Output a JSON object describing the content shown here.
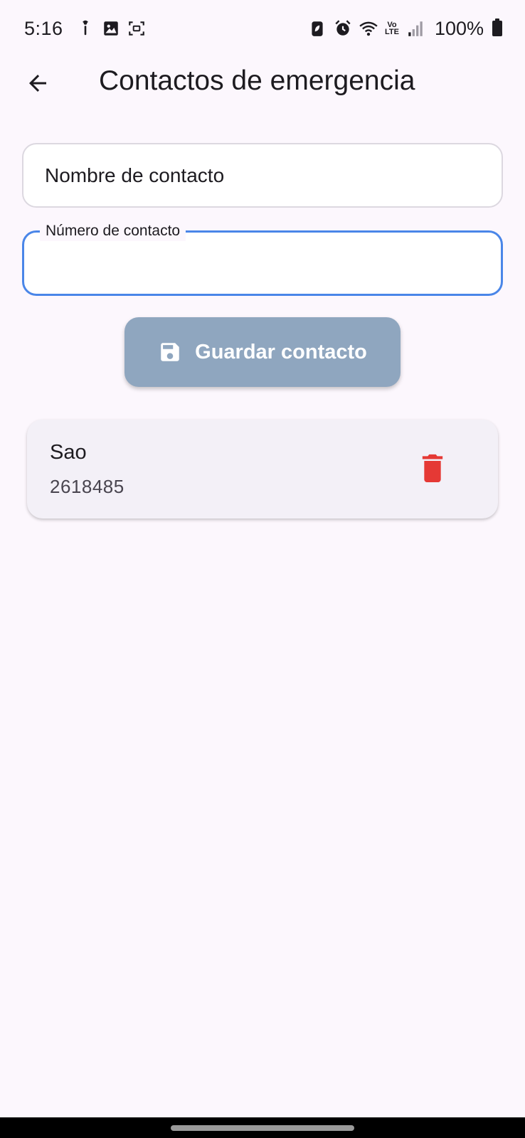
{
  "status_bar": {
    "time": "5:16",
    "battery": "100%",
    "network": [
      "Vo",
      "LTE"
    ],
    "left_icons": [
      "hotspot-icon",
      "image-icon",
      "screenshot-icon"
    ],
    "right_icons": [
      "battery-saver-icon",
      "alarm-icon",
      "wifi-icon",
      "volte-icon",
      "signal-icon",
      "battery-icon"
    ]
  },
  "app_bar": {
    "title": "Contactos de emergencia",
    "back_icon": "arrow-back-icon"
  },
  "form": {
    "name_field": {
      "placeholder": "Nombre de contacto",
      "value": ""
    },
    "number_field": {
      "label": "Número de contacto",
      "value": ""
    },
    "save_button": {
      "label": "Guardar contacto",
      "icon": "save-icon"
    }
  },
  "contacts": [
    {
      "name": "Sao",
      "number": "2618485"
    }
  ],
  "colors": {
    "background": "#fcf7fd",
    "focus_border": "#4a86e8",
    "button": "#8fa6bf",
    "card": "#f3f0f7",
    "delete": "#e53935"
  }
}
